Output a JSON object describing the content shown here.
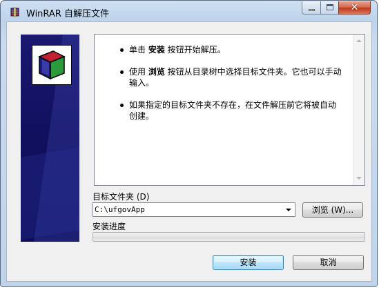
{
  "window": {
    "title": "WinRAR 自解压文件",
    "controls": {
      "minimize": "minimize",
      "maximize": "maximize",
      "close": "✕"
    }
  },
  "messages": [
    {
      "before": "单击 ",
      "bold": "安装",
      "after": " 按钮开始解压。"
    },
    {
      "before": "使用 ",
      "bold": "浏览",
      "after": " 按钮从目录树中选择目标文件夹。它也可以手动输入。"
    },
    {
      "before": "如果指定的目标文件夹不存在，在文件解压前它将被自动创建。",
      "bold": "",
      "after": ""
    }
  ],
  "destination": {
    "label": "目标文件夹 (D)",
    "path": "C:\\ufgovApp",
    "browse_label": "浏览 (W)..."
  },
  "progress": {
    "label": "安装进度",
    "value": 0
  },
  "buttons": {
    "install": "安装",
    "cancel": "取消"
  },
  "icons": {
    "app": "winrar-icon",
    "logo": "winrar-box-logo"
  }
}
